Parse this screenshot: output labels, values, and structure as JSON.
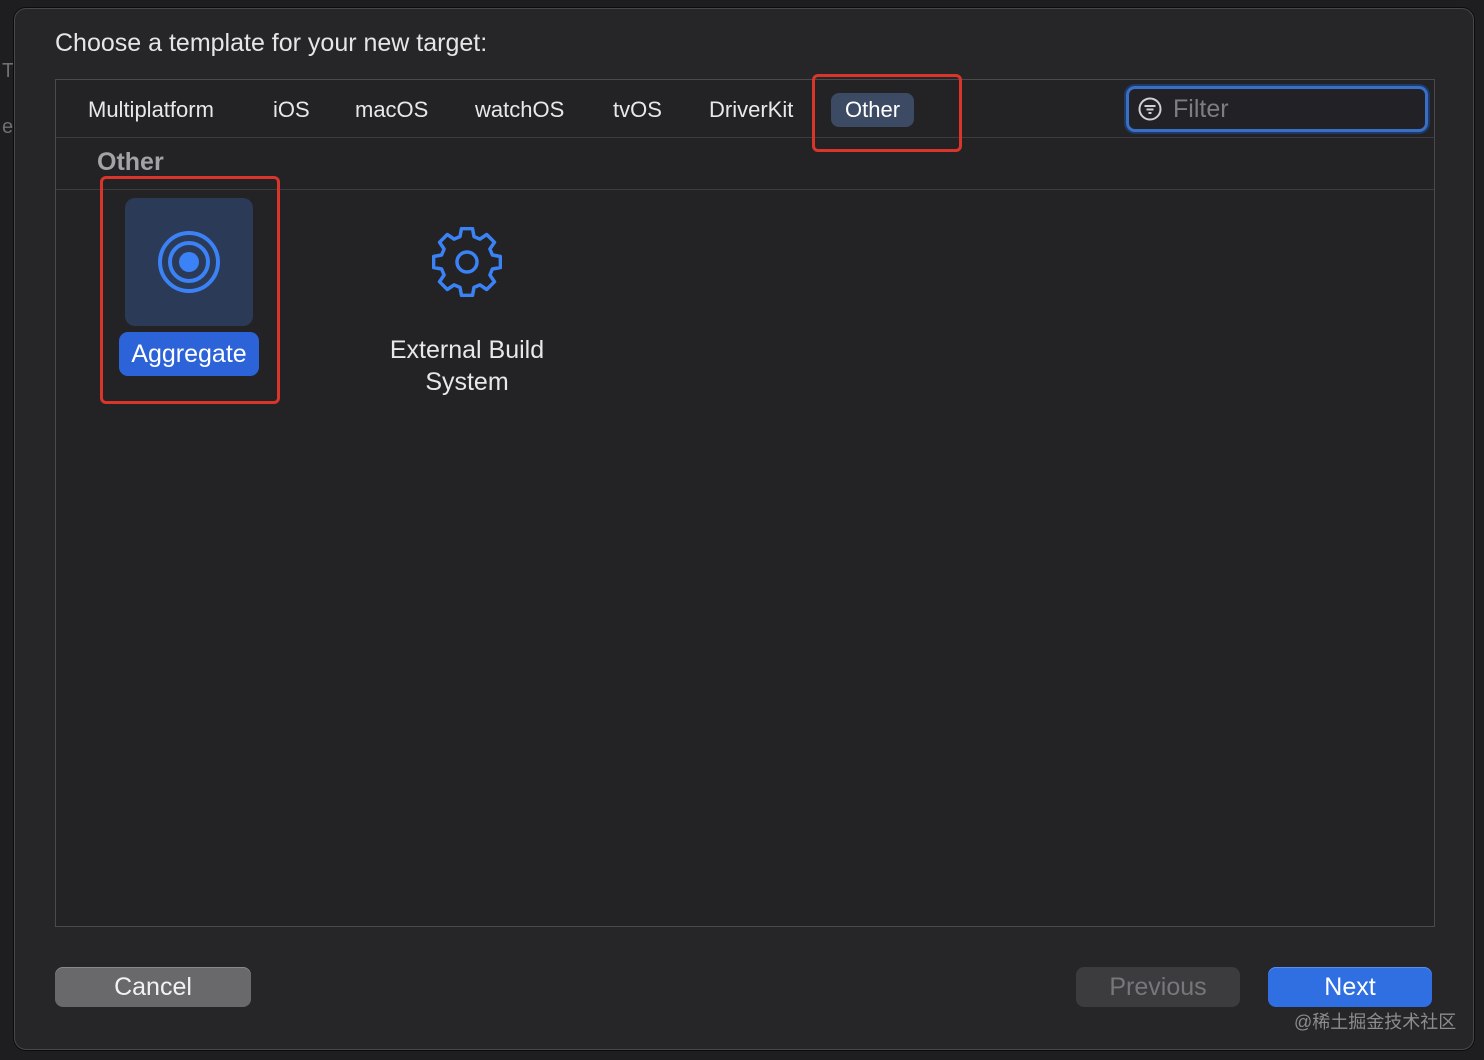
{
  "background": {
    "side_letters": [
      "T",
      "e"
    ]
  },
  "dialog": {
    "title": "Choose a template for your new target:",
    "tabs": [
      {
        "label": "Multiplatform",
        "selected": false
      },
      {
        "label": "iOS",
        "selected": false
      },
      {
        "label": "macOS",
        "selected": false
      },
      {
        "label": "watchOS",
        "selected": false
      },
      {
        "label": "tvOS",
        "selected": false
      },
      {
        "label": "DriverKit",
        "selected": false
      },
      {
        "label": "Other",
        "selected": true
      }
    ],
    "filter": {
      "placeholder": "Filter",
      "value": "",
      "icon": "filter-icon"
    },
    "section": {
      "title": "Other"
    },
    "templates": [
      {
        "label": "Aggregate",
        "icon": "aggregate-target-icon",
        "selected": true
      },
      {
        "label": "External Build\nSystem",
        "icon": "gear-icon",
        "selected": false
      }
    ],
    "buttons": {
      "cancel": "Cancel",
      "previous": "Previous",
      "next": "Next"
    }
  },
  "watermark": "@稀土掘金技术社区",
  "colors": {
    "accent": "#2f6fe2",
    "highlight_box": "#d9352b",
    "icon_blue": "#3b82f6"
  }
}
